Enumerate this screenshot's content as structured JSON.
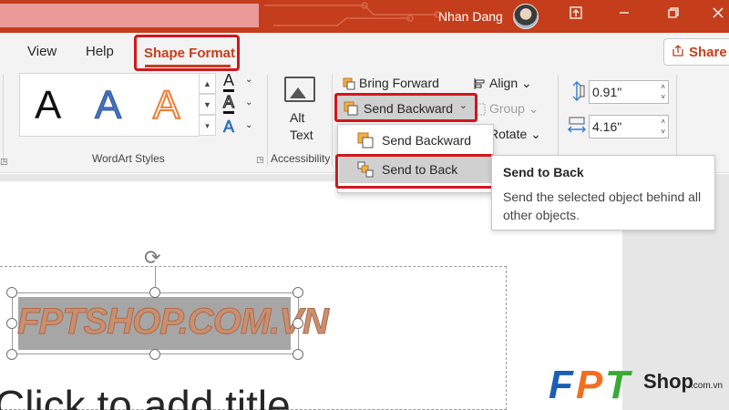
{
  "titlebar": {
    "user_name": "Nhan Dang",
    "accent": "#c43e1c"
  },
  "tabs": {
    "view": "View",
    "help": "Help",
    "shape_format": "Shape Format"
  },
  "share": {
    "label": "Share",
    "icon": "share-icon"
  },
  "wordart": {
    "styles": [
      "A",
      "A",
      "A"
    ],
    "group_label": "WordArt Styles",
    "text_fill_glyph": "A",
    "text_outline_glyph": "A",
    "text_effects_glyph": "A"
  },
  "accessibility": {
    "alt_line1": "Alt",
    "alt_line2": "Text",
    "group_label": "Accessibility"
  },
  "arrange": {
    "bring_forward": "Bring Forward",
    "send_backward": "Send Backward",
    "align": "Align",
    "group": "Group",
    "rotate": "Rotate"
  },
  "size": {
    "height": "0.91\"",
    "width": "4.16\""
  },
  "dropdown": {
    "send_backward": "Send Backward",
    "send_to_back": "Send to Back"
  },
  "tooltip": {
    "title": "Send to Back",
    "body": "Send the selected object behind all other objects."
  },
  "slide": {
    "wordart_text": "FPTSHOP.COM.VN",
    "title_placeholder": "Click to add title"
  },
  "watermark": {
    "brand_letters": "FPT",
    "shop": "Shop",
    "domain": ".com.vn"
  }
}
